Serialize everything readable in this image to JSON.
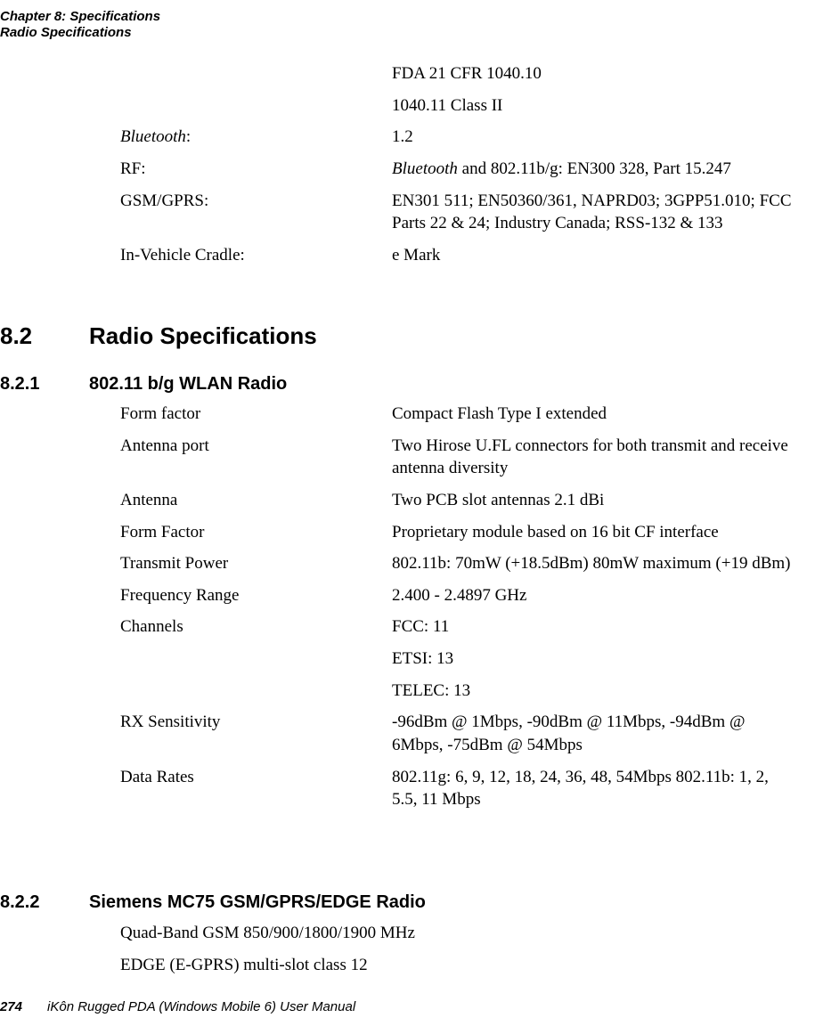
{
  "header": {
    "line1": "Chapter 8:  Specifications",
    "line2": "Radio Specifications"
  },
  "top_specs": {
    "fda_line1": "FDA 21 CFR 1040.10",
    "fda_line2": "1040.11 Class II",
    "bluetooth_label_italic": "Bluetooth",
    "bluetooth_label_colon": ":",
    "bluetooth_val": "1.2",
    "rf_label": "RF:",
    "rf_val_italic": "Bluetooth",
    "rf_val_rest": " and 802.11b/g: EN300 328, Part 15.247",
    "gsm_label": "GSM/GPRS:",
    "gsm_val": "EN301 511; EN50360/361, NAPRD03; 3GPP51.010; FCC Parts 22 & 24; Industry Canada; RSS-132 & 133",
    "cradle_label": "In-Vehicle Cradle:",
    "cradle_val": "e Mark"
  },
  "sec82": {
    "num": "8.2",
    "title": "Radio Specifications"
  },
  "sec821": {
    "num": "8.2.1",
    "title": "802.11 b/g WLAN Radio",
    "rows": [
      {
        "label": "Form factor",
        "val": "Compact Flash Type I extended"
      },
      {
        "label": "Antenna port",
        "val": "Two Hirose U.FL connectors for both transmit and receive antenna diversity"
      },
      {
        "label": "Antenna",
        "val": "Two PCB slot antennas 2.1 dBi"
      },
      {
        "label": "Form Factor",
        "val": "Proprietary module based on 16 bit CF interface"
      },
      {
        "label": "Transmit Power",
        "val": "802.11b: 70mW (+18.5dBm) 80mW maximum (+19 dBm)"
      },
      {
        "label": "Frequency Range",
        "val": " 2.400 - 2.4897 GHz"
      },
      {
        "label": "Channels",
        "val": "FCC: 11"
      },
      {
        "label": "",
        "val": "ETSI: 13"
      },
      {
        "label": "",
        "val": "TELEC: 13"
      },
      {
        "label": "RX Sensitivity",
        "val": "-96dBm @ 1Mbps, -90dBm @ 11Mbps, -94dBm @ 6Mbps, -75dBm @ 54Mbps"
      },
      {
        "label": "Data Rates",
        "val": "802.11g: 6, 9, 12, 18, 24, 36, 48, 54Mbps 802.11b: 1, 2, 5.5, 11 Mbps"
      }
    ]
  },
  "sec822": {
    "num": "8.2.2",
    "title": "Siemens MC75 GSM/GPRS/EDGE Radio",
    "line1": "Quad-Band GSM 850/900/1800/1900 MHz",
    "line2": "EDGE (E-GPRS) multi-slot class 12"
  },
  "footer": {
    "page_number": "274",
    "title": "iKôn Rugged PDA (Windows Mobile 6) User Manual"
  }
}
